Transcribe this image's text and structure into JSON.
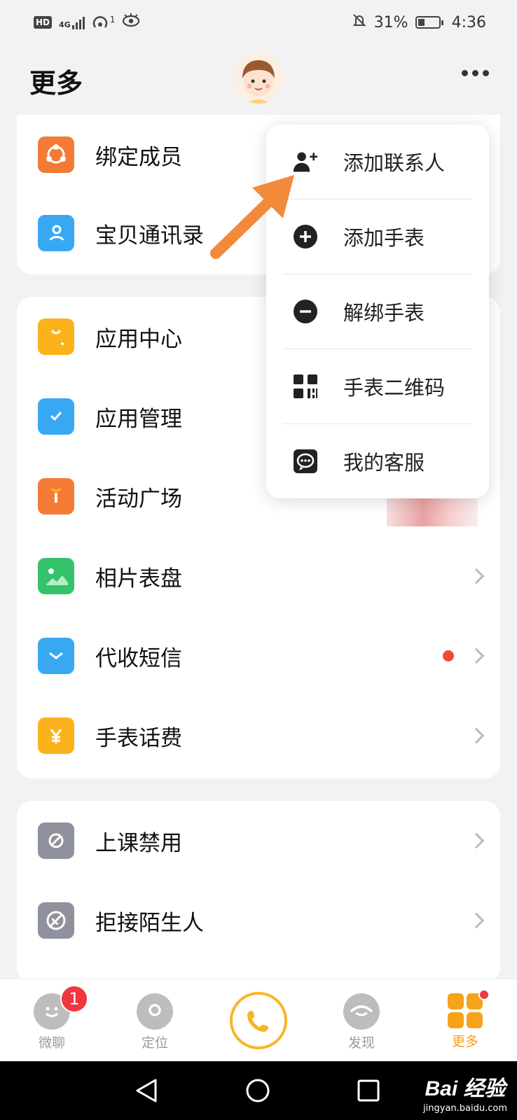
{
  "status_bar": {
    "hd": "HD",
    "net": "4G",
    "hotspot_count": "1",
    "battery_percent": "31%",
    "time": "4:36"
  },
  "header": {
    "title": "更多"
  },
  "card1": {
    "items": [
      {
        "label": "绑定成员",
        "icon": "share-bind-icon",
        "color": "#f47b35"
      },
      {
        "label": "宝贝通讯录",
        "icon": "contacts-book-icon",
        "color": "#39a8f3"
      }
    ]
  },
  "card2": {
    "items": [
      {
        "label": "应用中心",
        "icon": "shopping-bag-icon",
        "color": "#fbb21c"
      },
      {
        "label": "应用管理",
        "icon": "check-manage-icon",
        "color": "#39a8f3"
      },
      {
        "label": "活动广场",
        "icon": "gift-box-icon",
        "color": "#f47b35"
      },
      {
        "label": "相片表盘",
        "icon": "photo-icon",
        "color": "#34c26a"
      },
      {
        "label": "代收短信",
        "icon": "mail-icon",
        "color": "#39a8f3"
      },
      {
        "label": "手表话费",
        "icon": "yuan-icon",
        "color": "#fbb21c"
      }
    ]
  },
  "card3": {
    "items": [
      {
        "label": "上课禁用",
        "icon": "watch-disable-icon",
        "color": "#8f919c"
      },
      {
        "label": "拒接陌生人",
        "icon": "reject-call-icon",
        "color": "#8f919c"
      }
    ]
  },
  "dropdown": {
    "items": [
      {
        "label": "添加联系人",
        "icon": "add-contact-icon"
      },
      {
        "label": "添加手表",
        "icon": "plus-circle-icon"
      },
      {
        "label": "解绑手表",
        "icon": "minus-circle-icon"
      },
      {
        "label": "手表二维码",
        "icon": "qr-code-icon"
      },
      {
        "label": "我的客服",
        "icon": "customer-service-icon"
      }
    ]
  },
  "tabbar": {
    "chat": {
      "label": "微聊",
      "badge": "1"
    },
    "location": {
      "label": "定位"
    },
    "discover": {
      "label": "发现"
    },
    "more": {
      "label": "更多"
    }
  },
  "colors": {
    "accent": "#f7a21b",
    "badge": "#f0373f",
    "arrow": "#f28a3c"
  },
  "watermark": {
    "main": "Bai 经验",
    "sub": "jingyan.baidu.com"
  }
}
